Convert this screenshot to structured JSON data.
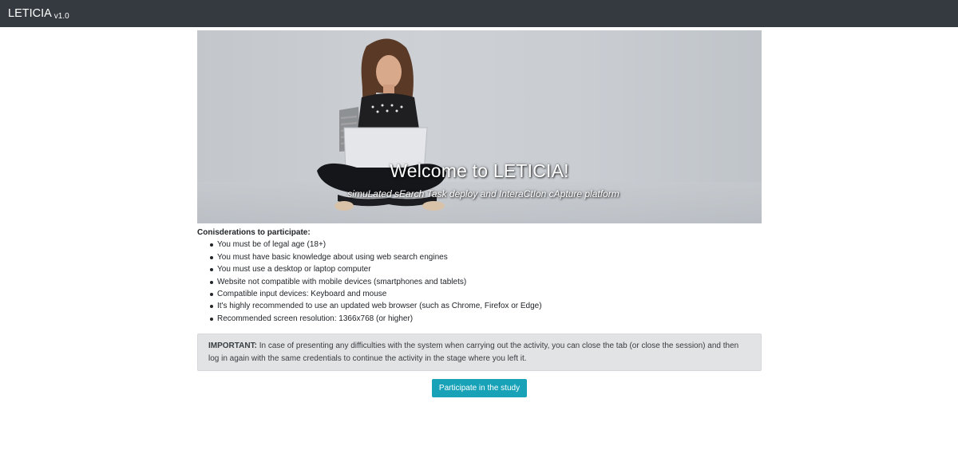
{
  "navbar": {
    "brand": "LETICIA",
    "version": "v1.0"
  },
  "hero": {
    "title": "Welcome to LETICIA!",
    "subtitle": "simuLated sEarch Task deploy and InteraCtIon cApture platform"
  },
  "considerations": {
    "title": "Conisderations to participate:",
    "items": [
      "You must be of legal age (18+)",
      "You must have basic knowledge about using web search engines",
      "You must use a desktop or laptop computer",
      "Website not compatible with mobile devices (smartphones and tablets)",
      "Compatible input devices: Keyboard and mouse",
      "It's highly recommended to use an updated web browser (such as Chrome, Firefox or Edge)",
      "Recommended screen resolution: 1366x768 (or higher)"
    ]
  },
  "alert": {
    "label": "IMPORTANT:",
    "text": "In case of presenting any difficulties with the system when carrying out the activity, you can close the tab (or close the session) and then log in again with the same credentials to continue the activity in the stage where you left it."
  },
  "actions": {
    "participate_label": "Participate in the study"
  },
  "colors": {
    "navbar": "#343a40",
    "button": "#17a2b8",
    "alert_bg": "#e2e3e5"
  }
}
